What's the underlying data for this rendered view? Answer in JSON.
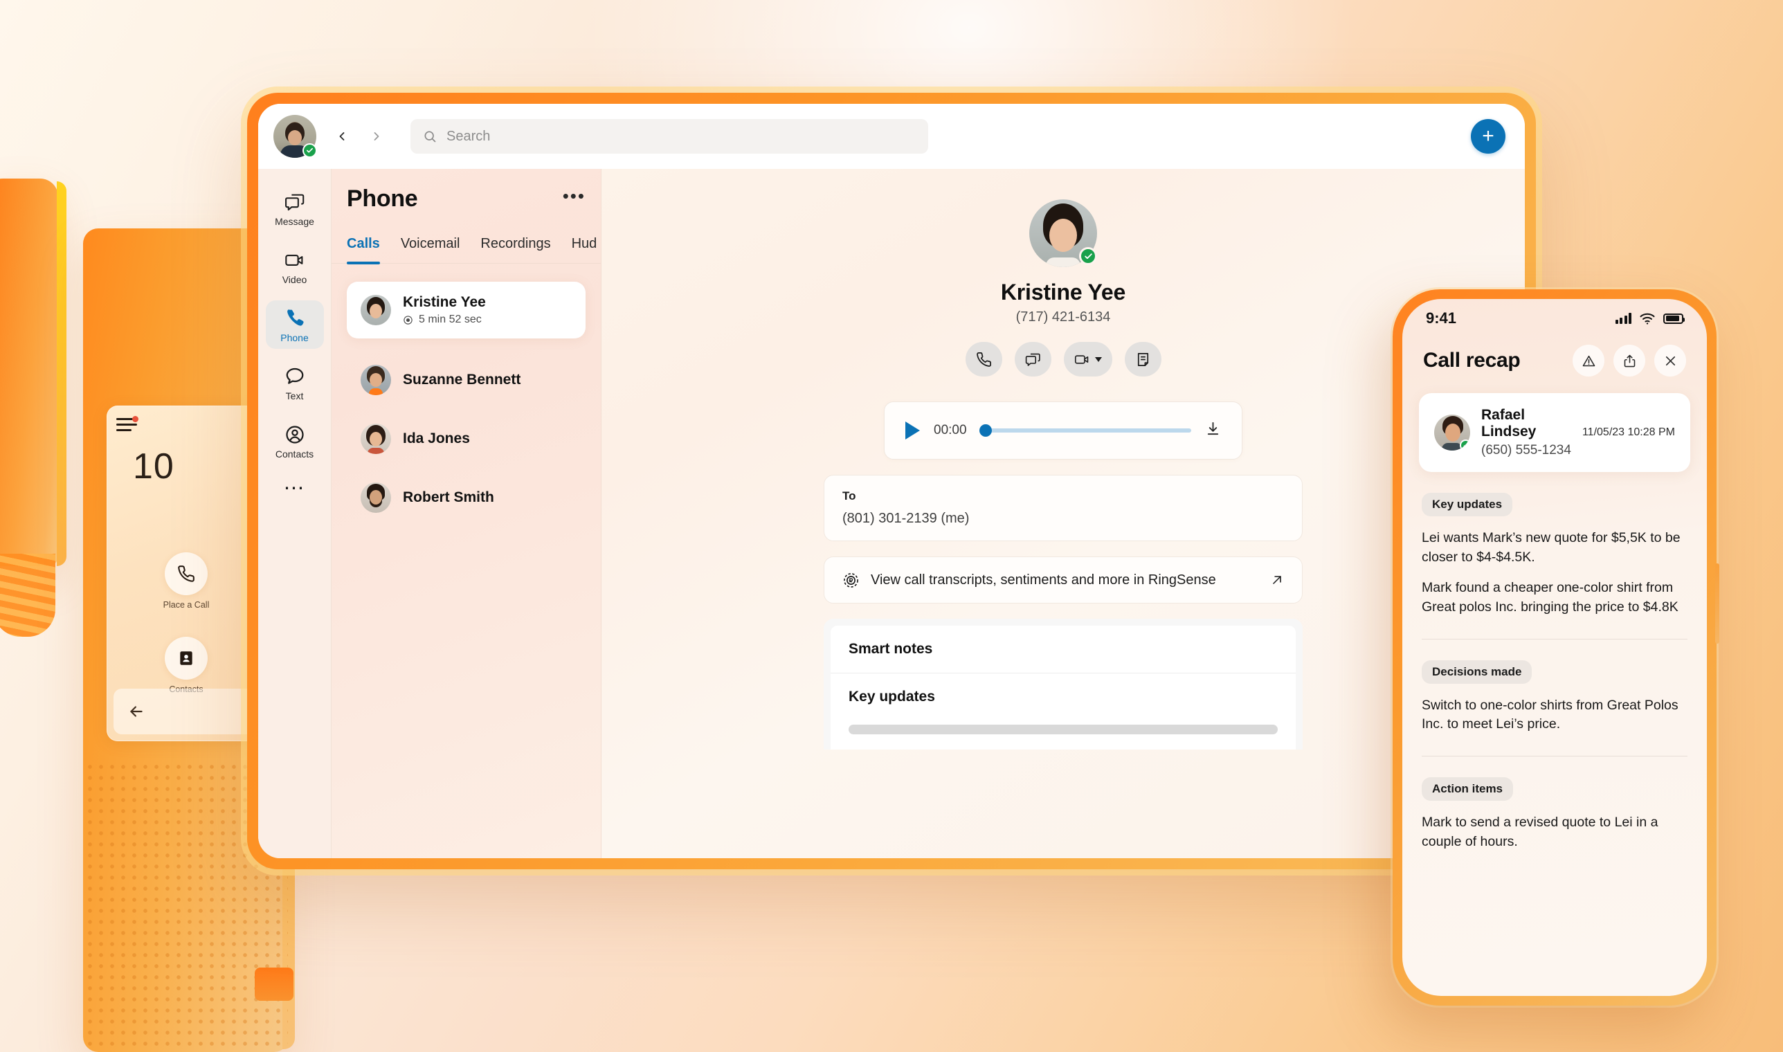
{
  "desktop": {
    "topbar": {
      "search_placeholder": "Search",
      "back_icon": "chevron-left-icon",
      "forward_icon": "chevron-right-icon",
      "plus_label": "+"
    },
    "rail": [
      {
        "label": "Message",
        "icon": "message-icon",
        "active": false
      },
      {
        "label": "Video",
        "icon": "video-icon",
        "active": false
      },
      {
        "label": "Phone",
        "icon": "phone-icon",
        "active": true
      },
      {
        "label": "Text",
        "icon": "text-bubble-icon",
        "active": false
      },
      {
        "label": "Contacts",
        "icon": "contacts-icon",
        "active": false
      },
      {
        "label": "More",
        "icon": "more-dots-icon",
        "active": false
      }
    ],
    "list": {
      "title": "Phone",
      "more_label": "•••",
      "tabs": [
        {
          "label": "Calls",
          "active": true
        },
        {
          "label": "Voicemail",
          "active": false
        },
        {
          "label": "Recordings",
          "active": false
        },
        {
          "label": "Hud",
          "active": false
        }
      ],
      "selected_call": {
        "name": "Kristine Yee",
        "duration": "5 min 52 sec"
      },
      "calls": [
        {
          "name": "Suzanne Bennett"
        },
        {
          "name": "Ida Jones"
        },
        {
          "name": "Robert Smith"
        }
      ]
    },
    "detail": {
      "name": "Kristine Yee",
      "phone": "(717) 421-6134",
      "actions": [
        {
          "name": "call-button",
          "icon": "phone-icon"
        },
        {
          "name": "message-button",
          "icon": "message-icon"
        },
        {
          "name": "video-button",
          "icon": "video-icon"
        },
        {
          "name": "note-button",
          "icon": "note-icon"
        }
      ],
      "player": {
        "time": "00:00",
        "progress_percent": 0
      },
      "to_card": {
        "label": "To",
        "value": "(801) 301-2139 (me)"
      },
      "ringsense": {
        "text": "View call transcripts, sentiments and more in RingSense"
      },
      "smart_notes": {
        "title": "Smart notes",
        "subtitle": "Key updates"
      }
    }
  },
  "mobile": {
    "status": {
      "time": "9:41"
    },
    "header": {
      "title": "Call recap",
      "actions": [
        {
          "name": "warning-button",
          "icon": "warning-triangle-icon"
        },
        {
          "name": "share-button",
          "icon": "share-icon"
        },
        {
          "name": "close-button",
          "icon": "close-icon"
        }
      ]
    },
    "contact": {
      "name": "Rafael Lindsey",
      "phone": "(650) 555-1234",
      "datetime": "11/05/23 10:28 PM"
    },
    "sections": [
      {
        "chip": "Key updates",
        "paragraphs": [
          "Lei wants Mark’s new quote for $5,5K to be closer to $4-$4.5K.",
          "Mark found a cheaper one-color shirt from Great polos Inc. bringing the price to $4.8K"
        ]
      },
      {
        "chip": "Decisions made",
        "paragraphs": [
          "Switch to one-color shirts from Great Polos Inc. to meet Lei’s price."
        ]
      },
      {
        "chip": "Action items",
        "paragraphs": [
          "Mark to send a revised quote to Lei in a couple of hours."
        ]
      }
    ]
  },
  "deskphone": {
    "number_fragment": "10",
    "buttons": [
      {
        "label": "Place a Call",
        "icon": "phone-icon"
      },
      {
        "label": "Contacts",
        "icon": "contact-card-icon"
      }
    ],
    "back_icon": "arrow-left-icon"
  },
  "colors": {
    "accent_blue": "#0b72b5",
    "brand_orange": "#ff7f1d",
    "status_green": "#19a14b"
  }
}
